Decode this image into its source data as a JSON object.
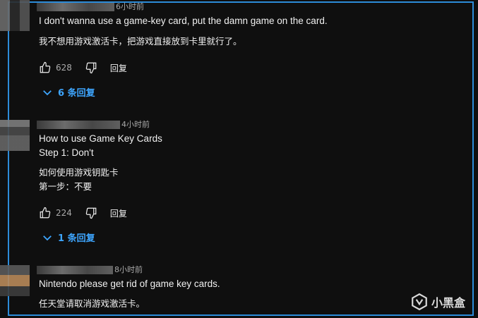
{
  "comments": [
    {
      "time": "6小时前",
      "text_en": "I don't wanna use a game-key card, put the damn game on the card.",
      "text_zh": "我不想用游戏激活卡，把游戏直接放到卡里就行了。",
      "likes": "628",
      "reply_label": "回复",
      "replies_label": "6 条回复"
    },
    {
      "time": "4小时前",
      "text_en_line1": "How to use Game Key Cards",
      "text_en_line2": "Step 1: Don't",
      "text_zh_line1": "如何使用游戏钥匙卡",
      "text_zh_line2": "第一步：不要",
      "likes": "224",
      "reply_label": "回复",
      "replies_label": "1 条回复"
    },
    {
      "time": "8小时前",
      "text_en": "Nintendo please get rid of game key cards.",
      "text_zh": "任天堂请取消游戏激活卡。"
    }
  ],
  "watermark": "小黑盒",
  "colors": {
    "accent": "#3ea6ff",
    "frame": "#2c8cd9",
    "background": "#0f0f0f"
  }
}
